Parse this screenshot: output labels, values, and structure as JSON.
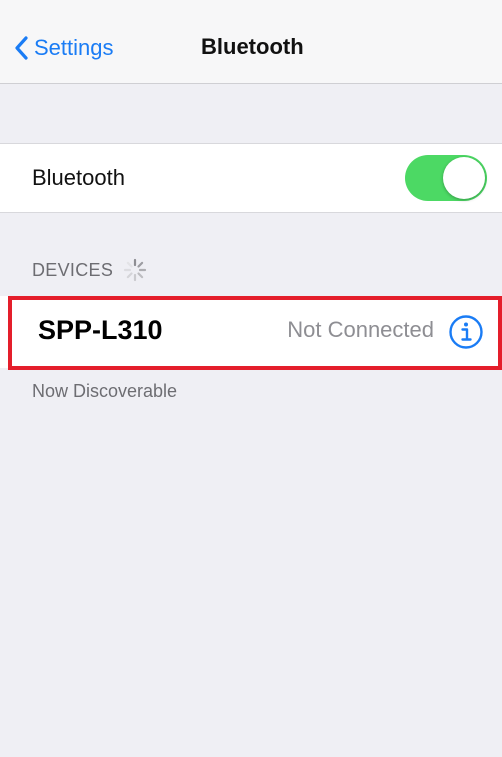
{
  "navbar": {
    "back_label": "Settings",
    "title": "Bluetooth"
  },
  "bluetooth": {
    "label": "Bluetooth",
    "enabled": true,
    "toggle_color": "#4cd964"
  },
  "devices": {
    "header": "DEVICES",
    "searching": true,
    "items": [
      {
        "name": "SPP-L310",
        "status": "Not Connected",
        "highlighted": true
      }
    ]
  },
  "footer_note": "Now Discoverable",
  "colors": {
    "accent": "#1a7cf5",
    "highlight": "#e41e2b"
  },
  "icons": {
    "back": "chevron-left-icon",
    "spinner": "activity-spinner-icon",
    "info": "info-circle-icon"
  }
}
